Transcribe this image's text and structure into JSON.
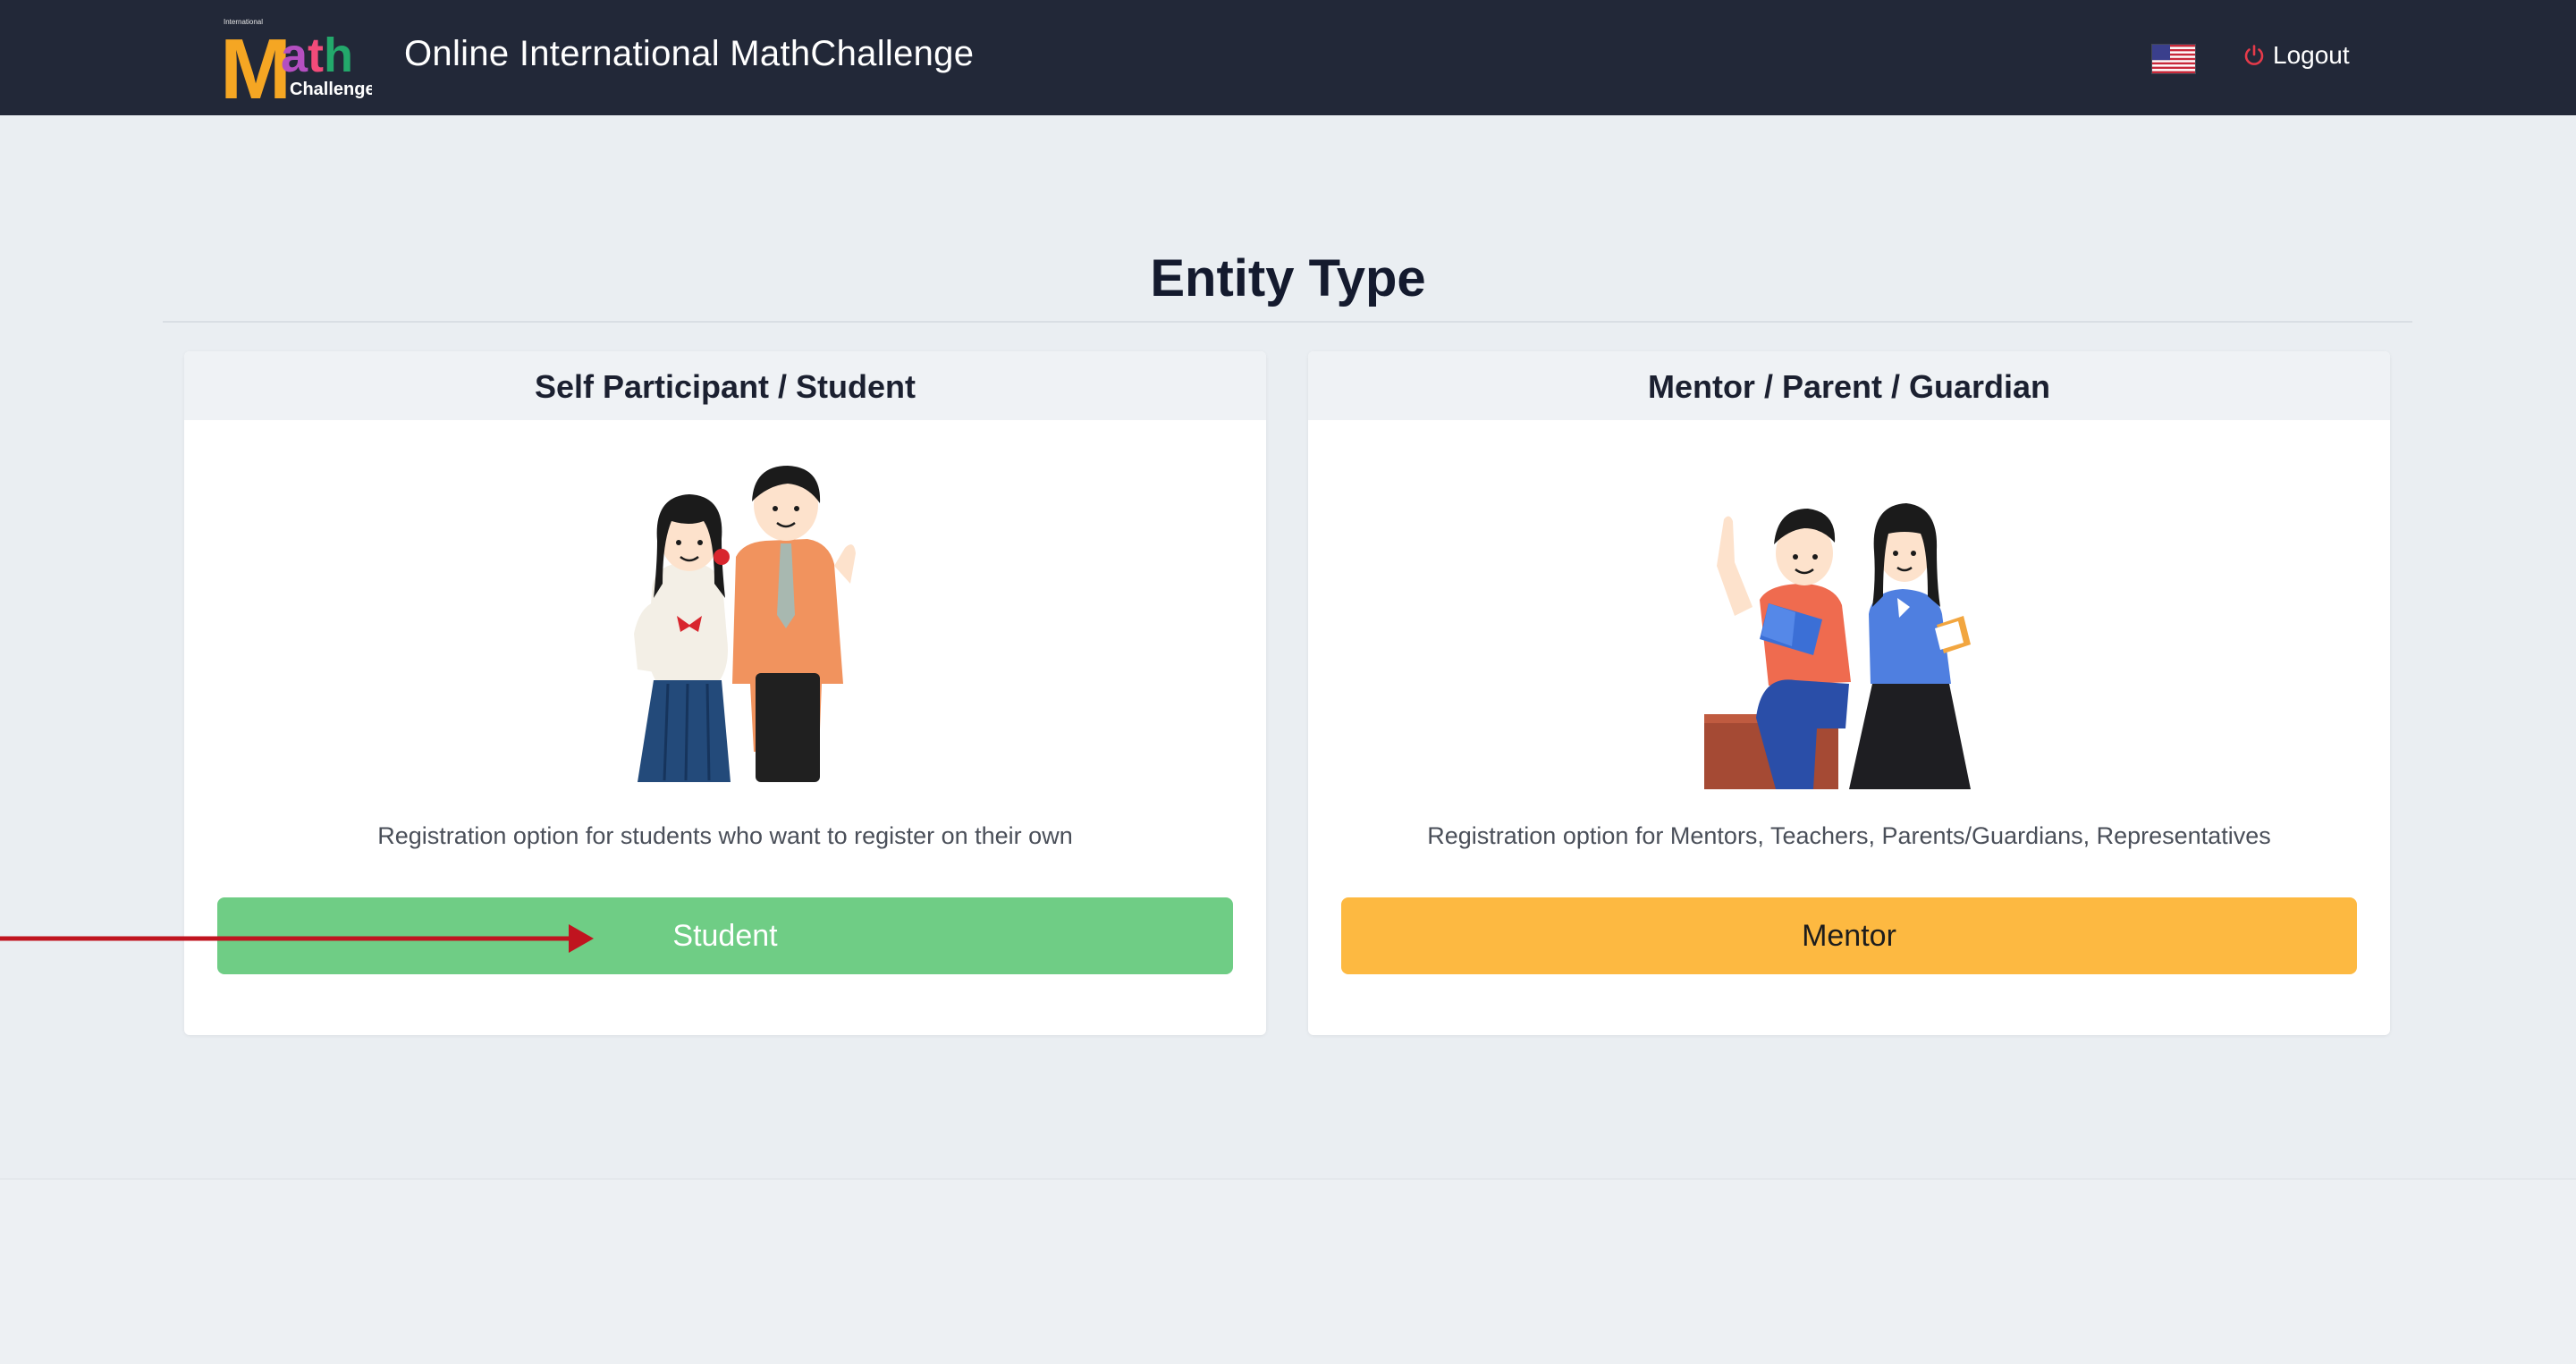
{
  "header": {
    "logo": {
      "top_text": "International",
      "big_letter": "M",
      "letters": "ath",
      "sub_text": "Challenge"
    },
    "title": "Online International MathChallenge",
    "language_flag": "us-flag-icon",
    "logout_icon": "power-icon",
    "logout_label": "Logout"
  },
  "page": {
    "title": "Entity Type"
  },
  "cards": [
    {
      "header": "Self Participant / Student",
      "description": "Registration option for students who want to register on their own",
      "button_label": "Student",
      "button_color": "#6fcd85",
      "illustration": "students-illustration"
    },
    {
      "header": "Mentor / Parent / Guardian",
      "description": "Registration option for Mentors, Teachers, Parents/Guardians, Representatives",
      "button_label": "Mentor",
      "button_color": "#fdb941",
      "illustration": "mentors-illustration"
    }
  ],
  "colors": {
    "header_bg": "#222838",
    "page_bg": "#eaeef2",
    "annotation_arrow": "#c0141f",
    "logout_icon": "#e53a4a"
  }
}
